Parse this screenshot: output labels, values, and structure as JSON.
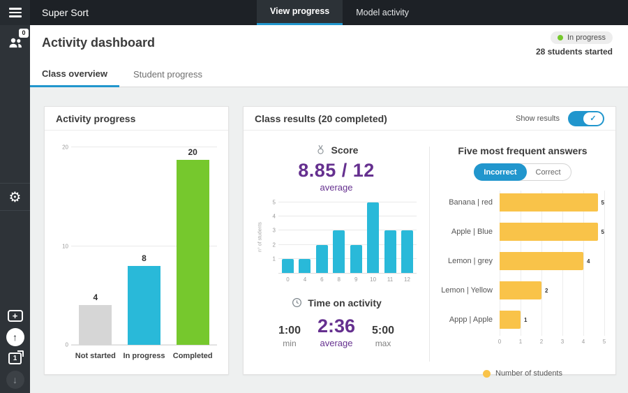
{
  "colors": {
    "accent_blue": "#2196cd",
    "green": "#76c82d",
    "cyan": "#29b9d9",
    "yellow": "#f9c349",
    "purple": "#65308f",
    "grey_bar": "#d6d6d6",
    "topbar_bg": "#1d2126",
    "sidebar_bg": "#2e3338"
  },
  "topbar": {
    "title": "Super Sort",
    "tabs": [
      {
        "label": "View progress",
        "active": true
      },
      {
        "label": "Model activity",
        "active": false
      }
    ]
  },
  "sidebar": {
    "people_badge": "0",
    "pages_badge": "1"
  },
  "header": {
    "title": "Activity dashboard",
    "status_label": "In progress",
    "students_started": "28 students started"
  },
  "nav_tabs": {
    "class_overview": "Class overview",
    "student_progress": "Student progress"
  },
  "activity_card": {
    "title": "Activity progress"
  },
  "results_card": {
    "title": "Class results (20 completed)",
    "show_results_label": "Show results",
    "score_label": "Score",
    "score_value": "8.85 / 12",
    "score_caption": "average",
    "time_label": "Time on activity",
    "time_min": "1:00",
    "time_min_label": "min",
    "time_avg": "2:36",
    "time_avg_label": "average",
    "time_max": "5:00",
    "time_max_label": "max",
    "answers_title": "Five most frequent answers",
    "toggle_incorrect": "Incorrect",
    "toggle_correct": "Correct",
    "legend": "Number of students"
  },
  "chart_data": [
    {
      "type": "bar",
      "title": "Activity progress",
      "categories": [
        "Not started",
        "In progress",
        "Completed"
      ],
      "values": [
        4,
        8,
        20
      ],
      "bar_colors": [
        "#d6d6d6",
        "#29b9d9",
        "#76c82d"
      ],
      "ylim": [
        0,
        20
      ],
      "yticks": [
        0,
        10,
        20
      ],
      "grid": true
    },
    {
      "type": "bar",
      "title": "Score distribution",
      "ylabel": "n° of students",
      "categories": [
        "0",
        "4",
        "6",
        "8",
        "9",
        "10",
        "11",
        "12"
      ],
      "values": [
        1,
        1,
        2,
        3,
        2,
        5,
        3,
        3
      ],
      "bar_color": "#29b9d9",
      "ylim": [
        0,
        5
      ],
      "yticks": [
        1,
        2,
        3,
        4,
        5
      ],
      "grid": true
    },
    {
      "type": "bar",
      "orientation": "horizontal",
      "title": "Five most frequent answers",
      "categories": [
        "Banana | red",
        "Apple | Blue",
        "Lemon | grey",
        "Lemon | Yellow",
        "Appp | Apple"
      ],
      "values": [
        5,
        5,
        4,
        2,
        1
      ],
      "bar_color": "#f9c349",
      "xlim": [
        0,
        5
      ],
      "xticks": [
        0,
        1,
        2,
        3,
        4,
        5
      ],
      "legend": "Number of students",
      "grid": true
    }
  ]
}
